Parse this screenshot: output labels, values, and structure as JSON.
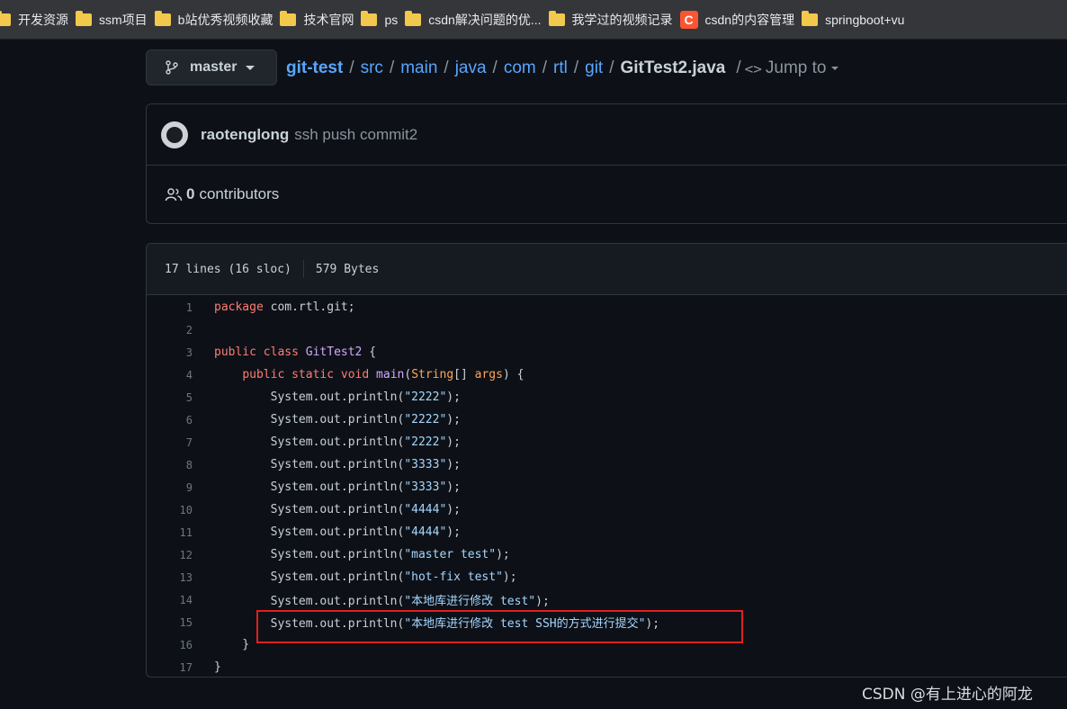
{
  "bookmarks": [
    {
      "label": "开发资源",
      "icon": "folder-icon"
    },
    {
      "label": "ssm项目",
      "icon": "folder-icon"
    },
    {
      "label": "b站优秀视频收藏",
      "icon": "folder-icon"
    },
    {
      "label": "技术官网",
      "icon": "folder-icon"
    },
    {
      "label": "ps",
      "icon": "folder-icon"
    },
    {
      "label": "csdn解决问题的优...",
      "icon": "folder-icon"
    },
    {
      "label": "我学过的视频记录",
      "icon": "folder-icon"
    },
    {
      "label": "csdn的内容管理",
      "icon": "csdn-icon",
      "icon_text": "C"
    },
    {
      "label": "springboot+vu",
      "icon": "folder-icon"
    }
  ],
  "branch": {
    "label": "master",
    "icon": "git-branch-icon"
  },
  "breadcrumb": {
    "repo": "git-test",
    "parts": [
      "src",
      "main",
      "java",
      "com",
      "rtl",
      "git"
    ],
    "file": "GitTest2.java",
    "separator": "/",
    "jump_label": "Jump to",
    "jump_icon": "<>"
  },
  "commit": {
    "author": "raotenglong",
    "message": "ssh push commit2"
  },
  "contributors": {
    "count": "0",
    "label": "contributors"
  },
  "file_info": {
    "lines": "17 lines (16 sloc)",
    "size": "579 Bytes"
  },
  "code_lines": [
    [
      {
        "t": "package",
        "c": "kw"
      },
      {
        "t": " com.rtl.git;"
      }
    ],
    [],
    [
      {
        "t": "public",
        "c": "kw"
      },
      {
        "t": " "
      },
      {
        "t": "class",
        "c": "kw"
      },
      {
        "t": " "
      },
      {
        "t": "GitTest2",
        "c": "cls"
      },
      {
        "t": " {"
      }
    ],
    [
      {
        "t": "    "
      },
      {
        "t": "public",
        "c": "kw"
      },
      {
        "t": " "
      },
      {
        "t": "static",
        "c": "kw"
      },
      {
        "t": " "
      },
      {
        "t": "void",
        "c": "kw"
      },
      {
        "t": " "
      },
      {
        "t": "main",
        "c": "fn"
      },
      {
        "t": "("
      },
      {
        "t": "String",
        "c": "typ"
      },
      {
        "t": "[] "
      },
      {
        "t": "args",
        "c": "typ"
      },
      {
        "t": ") {"
      }
    ],
    [
      {
        "t": "        System.out.println("
      },
      {
        "t": "\"2222\"",
        "c": "str"
      },
      {
        "t": ");"
      }
    ],
    [
      {
        "t": "        System.out.println("
      },
      {
        "t": "\"2222\"",
        "c": "str"
      },
      {
        "t": ");"
      }
    ],
    [
      {
        "t": "        System.out.println("
      },
      {
        "t": "\"2222\"",
        "c": "str"
      },
      {
        "t": ");"
      }
    ],
    [
      {
        "t": "        System.out.println("
      },
      {
        "t": "\"3333\"",
        "c": "str"
      },
      {
        "t": ");"
      }
    ],
    [
      {
        "t": "        System.out.println("
      },
      {
        "t": "\"3333\"",
        "c": "str"
      },
      {
        "t": ");"
      }
    ],
    [
      {
        "t": "        System.out.println("
      },
      {
        "t": "\"4444\"",
        "c": "str"
      },
      {
        "t": ");"
      }
    ],
    [
      {
        "t": "        System.out.println("
      },
      {
        "t": "\"4444\"",
        "c": "str"
      },
      {
        "t": ");"
      }
    ],
    [
      {
        "t": "        System.out.println("
      },
      {
        "t": "\"master test\"",
        "c": "str"
      },
      {
        "t": ");"
      }
    ],
    [
      {
        "t": "        System.out.println("
      },
      {
        "t": "\"hot-fix test\"",
        "c": "str"
      },
      {
        "t": ");"
      }
    ],
    [
      {
        "t": "        System.out.println("
      },
      {
        "t": "\"本地库进行修改 test\"",
        "c": "str"
      },
      {
        "t": ");"
      }
    ],
    [
      {
        "t": "        System.out.println("
      },
      {
        "t": "\"本地库进行修改 test SSH的方式进行提交\"",
        "c": "str"
      },
      {
        "t": ");"
      }
    ],
    [
      {
        "t": "    }"
      }
    ],
    [
      {
        "t": "}"
      }
    ]
  ],
  "watermark": "CSDN @有上进心的阿龙",
  "colors": {
    "background": "#0d1117",
    "link": "#58a6ff",
    "keyword": "#ff7b72",
    "string": "#a5d6ff",
    "highlight_box": "#e0201f"
  }
}
